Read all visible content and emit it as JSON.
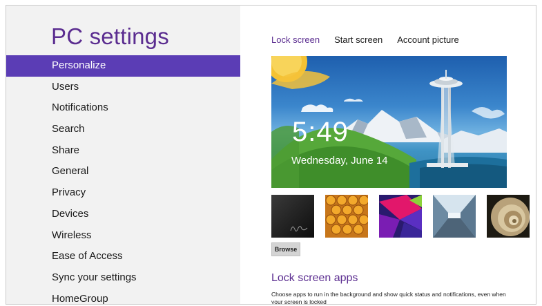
{
  "app": {
    "title": "PC settings"
  },
  "sidebar": {
    "items": [
      {
        "label": "Personalize",
        "active": true
      },
      {
        "label": "Users"
      },
      {
        "label": "Notifications"
      },
      {
        "label": "Search"
      },
      {
        "label": "Share"
      },
      {
        "label": "General"
      },
      {
        "label": "Privacy"
      },
      {
        "label": "Devices"
      },
      {
        "label": "Wireless"
      },
      {
        "label": "Ease of Access"
      },
      {
        "label": "Sync your settings"
      },
      {
        "label": "HomeGroup"
      }
    ]
  },
  "tabs": [
    {
      "label": "Lock screen",
      "active": true
    },
    {
      "label": "Start screen"
    },
    {
      "label": "Account picture"
    }
  ],
  "lock_preview": {
    "time": "5:49",
    "date": "Wednesday, June 14"
  },
  "browse_label": "Browse",
  "lock_apps": {
    "title": "Lock screen apps",
    "description": "Choose apps to run in the background and show quick status and notifications, even when your screen is locked"
  },
  "colors": {
    "accent": "#5b2d90",
    "selection": "#5b3db5",
    "sidebar_bg": "#f2f2f2"
  }
}
